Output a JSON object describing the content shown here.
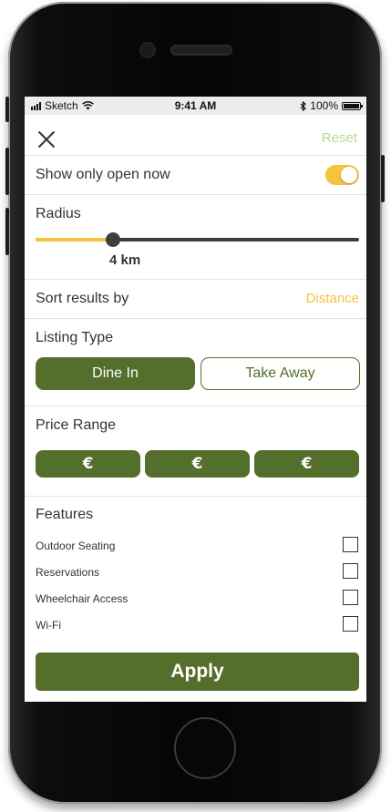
{
  "status_bar": {
    "carrier": "Sketch",
    "time": "9:41 AM",
    "battery": "100%",
    "battery_level": 1.0,
    "wifi_icon": "wifi-icon",
    "bluetooth_icon": "bluetooth-icon"
  },
  "header": {
    "close_icon": "close-icon",
    "reset_label": "Reset"
  },
  "open_now": {
    "label": "Show only open now",
    "enabled": true
  },
  "radius": {
    "label": "Radius",
    "value_label": "4 km",
    "fraction": 0.24
  },
  "sort": {
    "label": "Sort results by",
    "value": "Distance"
  },
  "listing_type": {
    "label": "Listing Type",
    "options": [
      "Dine In",
      "Take Away"
    ],
    "selected": "Dine In"
  },
  "price_range": {
    "label": "Price Range",
    "options": [
      "€",
      "€",
      "€"
    ]
  },
  "features": {
    "label": "Features",
    "items": [
      {
        "label": "Outdoor Seating",
        "checked": false
      },
      {
        "label": "Reservations",
        "checked": false
      },
      {
        "label": "Wheelchair Access",
        "checked": false
      },
      {
        "label": "Wi-Fi",
        "checked": false
      }
    ]
  },
  "apply_label": "Apply",
  "colors": {
    "accent_yellow": "#f6c33e",
    "primary_green": "#546e2c",
    "reset_green": "#b6dc8c"
  }
}
